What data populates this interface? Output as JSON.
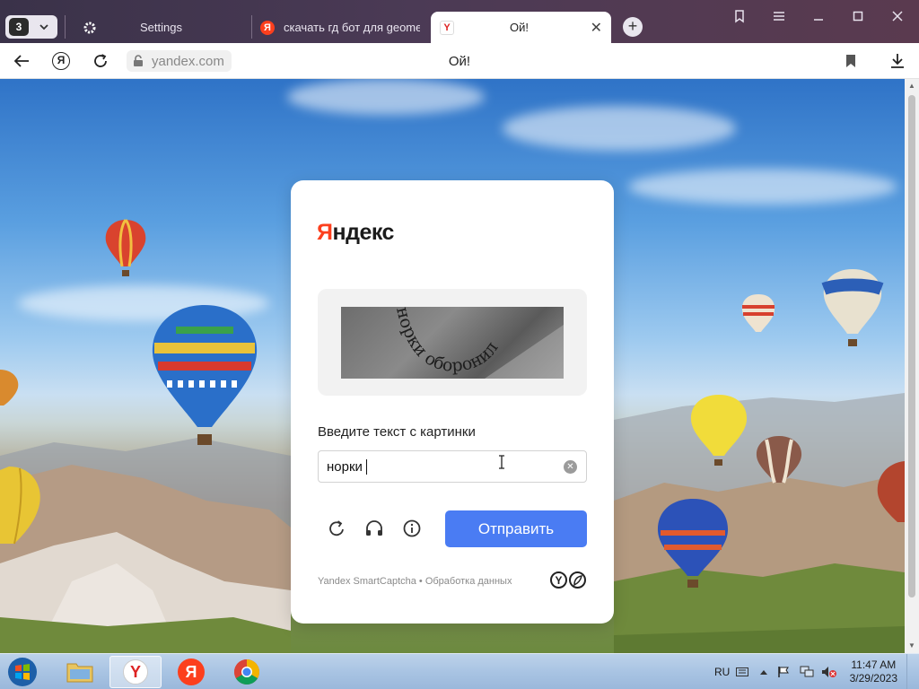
{
  "browser": {
    "tab_count": "3",
    "tabs": [
      {
        "label": "Settings"
      },
      {
        "label": "скачать гд бот для geomet"
      },
      {
        "label": "Ой!"
      }
    ],
    "address": "yandex.com",
    "page_title": "Ой!"
  },
  "captcha": {
    "logo_first": "Я",
    "logo_rest": "ндекс",
    "image_text": "норки оборонил",
    "prompt": "Введите текст с картинки",
    "input_value": "норки ",
    "submit_label": "Отправить",
    "footer_brand": "Yandex SmartCaptcha",
    "footer_dot": " • ",
    "footer_link": "Обработка данных",
    "accent_color": "#4a7cf3",
    "brand_red": "#fc3f1d"
  },
  "taskbar": {
    "language": "RU",
    "time": "11:47 AM",
    "date": "3/29/2023",
    "apps": [
      "start-orb",
      "file-explorer",
      "yandex-browser",
      "yandex",
      "chrome"
    ]
  }
}
